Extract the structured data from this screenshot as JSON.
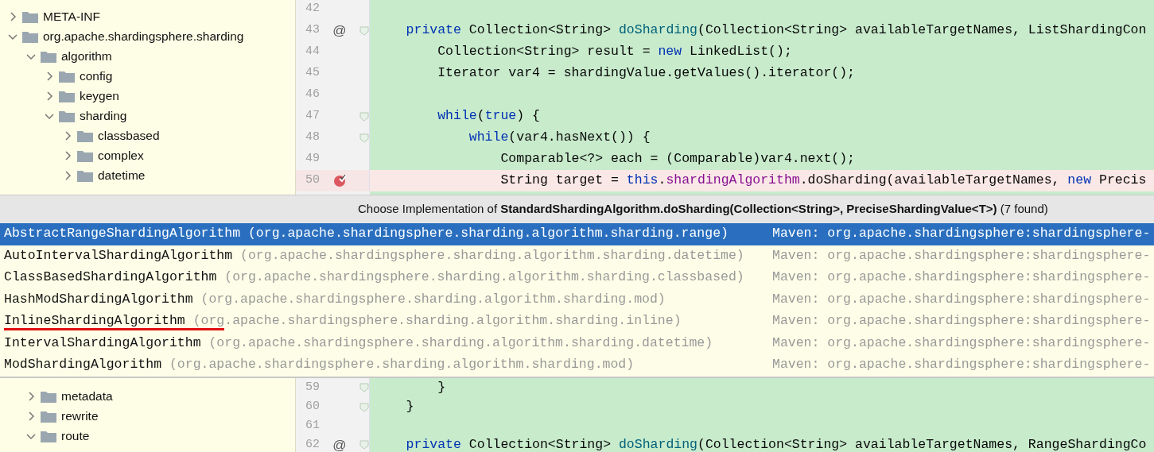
{
  "project_tree_upper": [
    {
      "label": "META-INF",
      "expanded": false
    },
    {
      "label": "org.apache.shardingsphere.sharding",
      "expanded": true,
      "children": [
        {
          "label": "algorithm",
          "expanded": true,
          "children": [
            {
              "label": "config",
              "expanded": false
            },
            {
              "label": "keygen",
              "expanded": false
            },
            {
              "label": "sharding",
              "expanded": true,
              "children": [
                {
                  "label": "classbased",
                  "expanded": false
                },
                {
                  "label": "complex",
                  "expanded": false
                },
                {
                  "label": "datetime",
                  "expanded": false
                }
              ]
            }
          ]
        }
      ]
    }
  ],
  "editor_upper": [
    {
      "number": "42",
      "fold": false,
      "breakpoint": false
    },
    {
      "number": "43",
      "marker": "@",
      "fold": true,
      "breakpoint": false,
      "tokens": [
        {
          "kind": "keyword",
          "text": "    private"
        },
        {
          "kind": "plain",
          "text": " Collection<String> "
        },
        {
          "kind": "method",
          "text": "doSharding"
        },
        {
          "kind": "plain",
          "text": "(Collection<String> availableTargetNames, ListShardingCon"
        }
      ]
    },
    {
      "number": "44",
      "fold": false,
      "breakpoint": false,
      "tokens": [
        {
          "kind": "plain",
          "text": "        Collection<String> result = "
        },
        {
          "kind": "keyword",
          "text": "new"
        },
        {
          "kind": "plain",
          "text": " LinkedList();"
        }
      ]
    },
    {
      "number": "45",
      "fold": false,
      "breakpoint": false,
      "tokens": [
        {
          "kind": "plain",
          "text": "        Iterator var4 = shardingValue.getValues().iterator();"
        }
      ]
    },
    {
      "number": "46",
      "fold": false,
      "breakpoint": false
    },
    {
      "number": "47",
      "fold": true,
      "breakpoint": false,
      "tokens": [
        {
          "kind": "keyword",
          "text": "        while"
        },
        {
          "kind": "plain",
          "text": "("
        },
        {
          "kind": "keyword",
          "text": "true"
        },
        {
          "kind": "plain",
          "text": ") {"
        }
      ]
    },
    {
      "number": "48",
      "fold": true,
      "breakpoint": false,
      "tokens": [
        {
          "kind": "keyword",
          "text": "            while"
        },
        {
          "kind": "plain",
          "text": "(var4.hasNext()) {"
        }
      ]
    },
    {
      "number": "49",
      "fold": false,
      "breakpoint": false,
      "tokens": [
        {
          "kind": "plain",
          "text": "                Comparable<?> each = (Comparable)var4.next();"
        }
      ]
    },
    {
      "number": "50",
      "fold": false,
      "breakpoint": true,
      "tokens": [
        {
          "kind": "plain",
          "text": "                String target = "
        },
        {
          "kind": "keyword",
          "text": "this"
        },
        {
          "kind": "plain",
          "text": "."
        },
        {
          "kind": "field",
          "text": "shardingAlgorithm"
        },
        {
          "kind": "plain",
          "text": ".doSharding(availableTargetNames, "
        },
        {
          "kind": "keyword",
          "text": "new"
        },
        {
          "kind": "plain",
          "text": " Precis"
        }
      ]
    }
  ],
  "popup": {
    "title": "Choose Implementation of **StandardShardingAlgorithm.doSharding(Collection<String>, PreciseShardingValue<T>)** (7 found)",
    "items": [
      {
        "name": "AbstractRangeShardingAlgorithm",
        "package": "(org.apache.shardingsphere.sharding.algorithm.sharding.range)",
        "location": "Maven: org.apache.shardingsphere:shardingsphere-",
        "selected": true,
        "underlined": false
      },
      {
        "name": "AutoIntervalShardingAlgorithm",
        "package": "(org.apache.shardingsphere.sharding.algorithm.sharding.datetime)",
        "location": "Maven: org.apache.shardingsphere:shardingsphere-",
        "selected": false,
        "underlined": false
      },
      {
        "name": "ClassBasedShardingAlgorithm",
        "package": "(org.apache.shardingsphere.sharding.algorithm.sharding.classbased)",
        "location": "Maven: org.apache.shardingsphere:shardingsphere-",
        "selected": false,
        "underlined": false
      },
      {
        "name": "HashModShardingAlgorithm",
        "package": "(org.apache.shardingsphere.sharding.algorithm.sharding.mod)",
        "location": "Maven: org.apache.shardingsphere:shardingsphere-",
        "selected": false,
        "underlined": false
      },
      {
        "name": "InlineShardingAlgorithm",
        "package": "(org.apache.shardingsphere.sharding.algorithm.sharding.inline)",
        "location": "Maven: org.apache.shardingsphere:shardingsphere-",
        "selected": false,
        "underlined": true
      },
      {
        "name": "IntervalShardingAlgorithm",
        "package": "(org.apache.shardingsphere.sharding.algorithm.sharding.datetime)",
        "location": "Maven: org.apache.shardingsphere:shardingsphere-",
        "selected": false,
        "underlined": false
      },
      {
        "name": "ModShardingAlgorithm",
        "package": "(org.apache.shardingsphere.sharding.algorithm.sharding.mod)",
        "location": "Maven: org.apache.shardingsphere:shardingsphere-",
        "selected": false,
        "underlined": false
      }
    ]
  },
  "project_tree_lower": [
    {
      "label": "metadata",
      "expanded": false
    },
    {
      "label": "rewrite",
      "expanded": false
    },
    {
      "label": "route",
      "expanded": true
    }
  ],
  "editor_lower": [
    {
      "number": "59",
      "fold": true,
      "breakpoint": false,
      "tokens": [
        {
          "kind": "plain",
          "text": "        }"
        }
      ]
    },
    {
      "number": "60",
      "fold": true,
      "breakpoint": false,
      "tokens": [
        {
          "kind": "plain",
          "text": "    }"
        }
      ]
    },
    {
      "number": "61",
      "fold": false,
      "breakpoint": false
    },
    {
      "number": "62",
      "marker": "@",
      "fold": true,
      "breakpoint": false,
      "tokens": [
        {
          "kind": "keyword",
          "text": "    private"
        },
        {
          "kind": "plain",
          "text": " Collection<String> "
        },
        {
          "kind": "method",
          "text": "doSharding"
        },
        {
          "kind": "plain",
          "text": "(Collection<String> availableTargetNames, RangeShardingCo"
        }
      ]
    }
  ]
}
